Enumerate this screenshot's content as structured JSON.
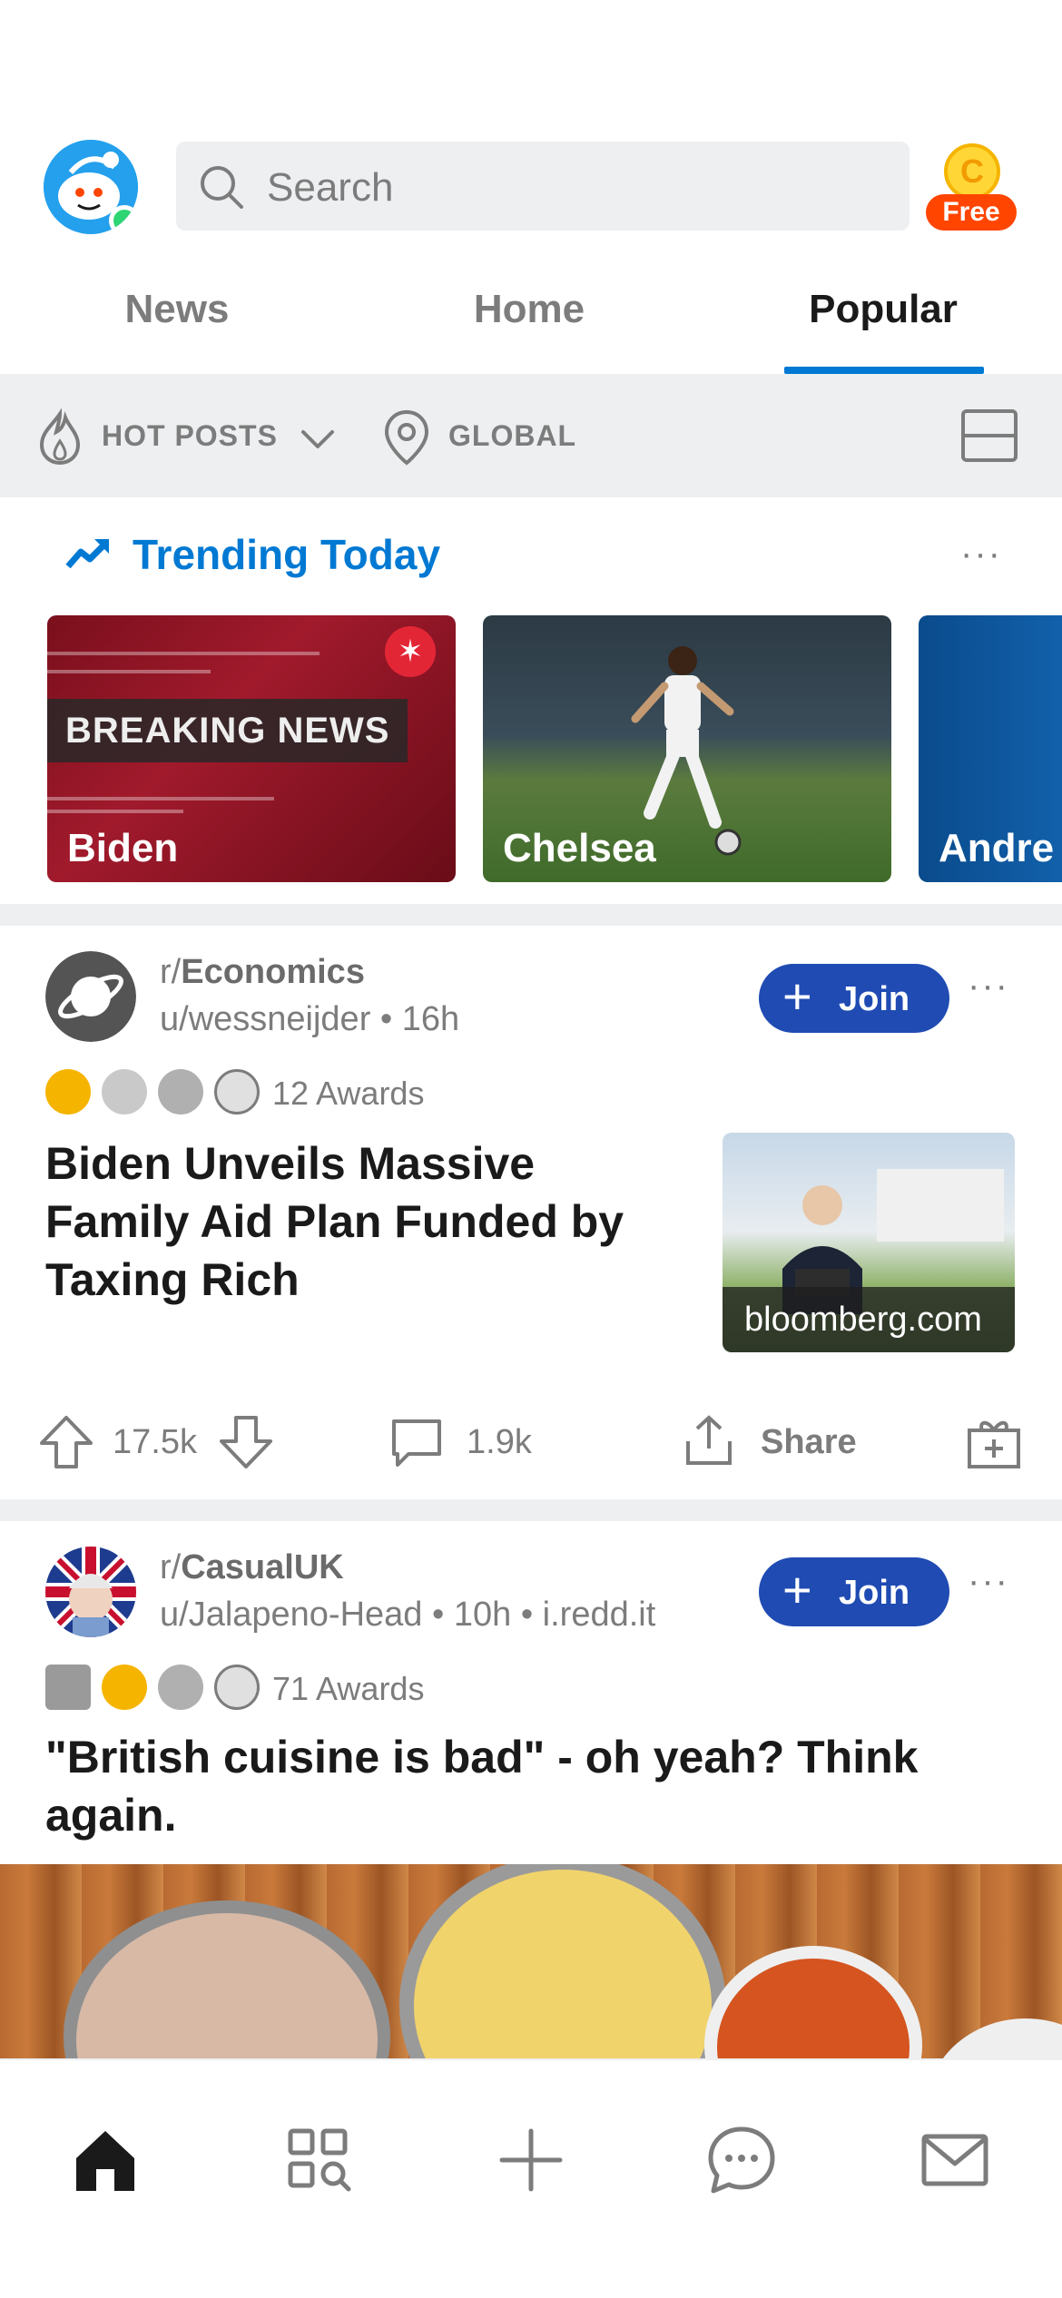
{
  "header": {
    "search_placeholder": "Search",
    "coin_label": "Free",
    "coin_symbol": "C"
  },
  "tabs": [
    {
      "label": "News",
      "active": false
    },
    {
      "label": "Home",
      "active": false
    },
    {
      "label": "Popular",
      "active": true
    }
  ],
  "filter": {
    "sort_label": "HOT POSTS",
    "location_label": "GLOBAL"
  },
  "trending": {
    "title": "Trending Today",
    "more_label": "···",
    "cards": [
      {
        "label": "Biden",
        "overlay": "BREAKING NEWS"
      },
      {
        "label": "Chelsea"
      },
      {
        "label": "Andre"
      }
    ]
  },
  "posts": [
    {
      "subreddit_prefix": "r/",
      "subreddit": "Economics",
      "meta": "u/wessneijder • 16h",
      "join_label": "Join",
      "awards_label": "12 Awards",
      "title_lines": [
        "Biden Unveils Massive",
        "Family Aid Plan Funded by",
        "Taxing Rich"
      ],
      "thumb_caption": "bloomberg.com",
      "upvotes": "17.5k",
      "comments": "1.9k",
      "share_label": "Share"
    },
    {
      "subreddit_prefix": "r/",
      "subreddit": "CasualUK",
      "meta": "u/Jalapeno-Head • 10h • i.redd.it",
      "join_label": "Join",
      "awards_label": "71 Awards",
      "title_lines": [
        "\"British cuisine is bad\" - oh yeah? Think",
        "again."
      ]
    }
  ],
  "colors": {
    "accent_blue": "#0079d3",
    "join_blue": "#1f4bb3",
    "coin_orange": "#ff4500",
    "muted": "#7c7c7c"
  },
  "icons": {
    "bottom_nav": [
      "home-icon",
      "discover-icon",
      "create-icon",
      "chat-icon",
      "inbox-icon"
    ]
  }
}
